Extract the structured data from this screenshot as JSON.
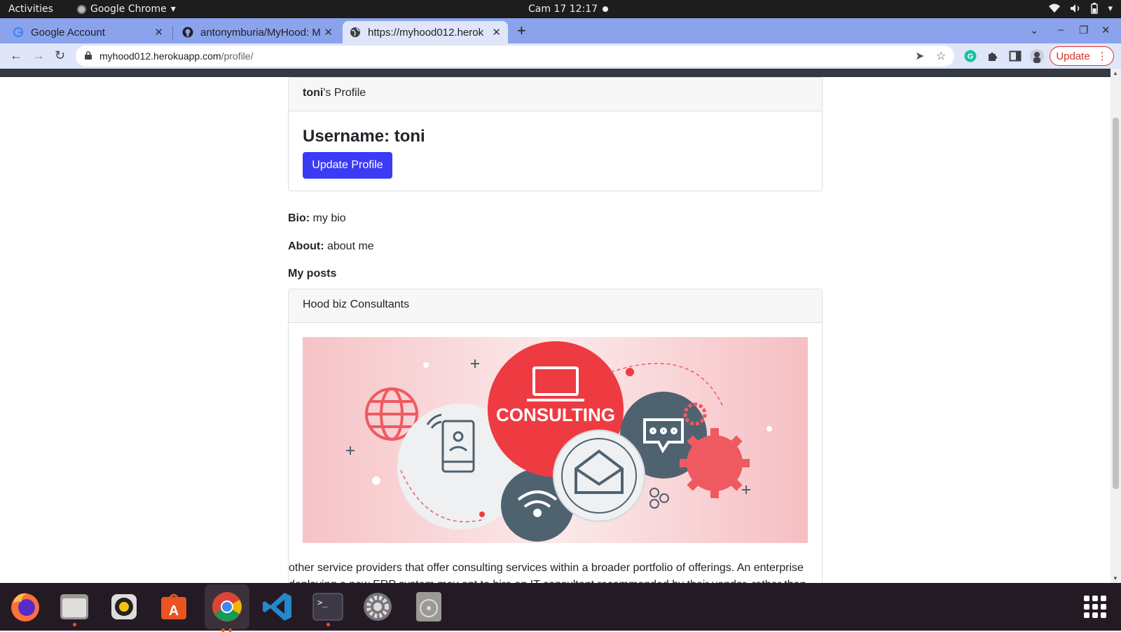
{
  "system_bar": {
    "activities": "Activities",
    "app_name": "Google Chrome",
    "clock": "Cam 17  12:17"
  },
  "browser": {
    "tabs": [
      {
        "title": "Google Account",
        "icon": "google-icon"
      },
      {
        "title": "antonymburia/MyHood: M",
        "icon": "github-icon"
      },
      {
        "title": "https://myhood012.herok",
        "icon": "globe-icon",
        "active": true
      }
    ],
    "address": {
      "host": "myhood012.herokuapp.com",
      "path": "/profile/"
    },
    "update_label": "Update"
  },
  "profile": {
    "header_name": "toni",
    "header_suffix": "'s Profile",
    "username_line": "Username: toni",
    "update_button": "Update Profile",
    "bio_label": "Bio:",
    "bio_value": " my bio",
    "about_label": "About:",
    "about_value": " about me"
  },
  "posts": {
    "heading": "My posts",
    "items": [
      {
        "title": "Hood biz Consultants",
        "image_label": "CONSULTING",
        "excerpt": "other service providers that offer consulting services within a broader portfolio of offerings. An enterprise deploying a new ERP system may opt to hire an IT consultant recommended by their vendor, rather than"
      }
    ]
  },
  "colors": {
    "primary_button": "#3b3bf5",
    "tab_strip": "#8aa3ec",
    "toolbar": "#dfe6f9",
    "navbar_dark": "#343a40",
    "consulting_red": "#ee3b41",
    "consulting_slate": "#4f6270"
  },
  "dock": [
    "firefox-icon",
    "files-icon",
    "rhythmbox-icon",
    "software-icon",
    "chrome-icon",
    "vscode-icon",
    "terminal-icon",
    "settings-icon",
    "disk-icon",
    "app-grid-icon"
  ]
}
